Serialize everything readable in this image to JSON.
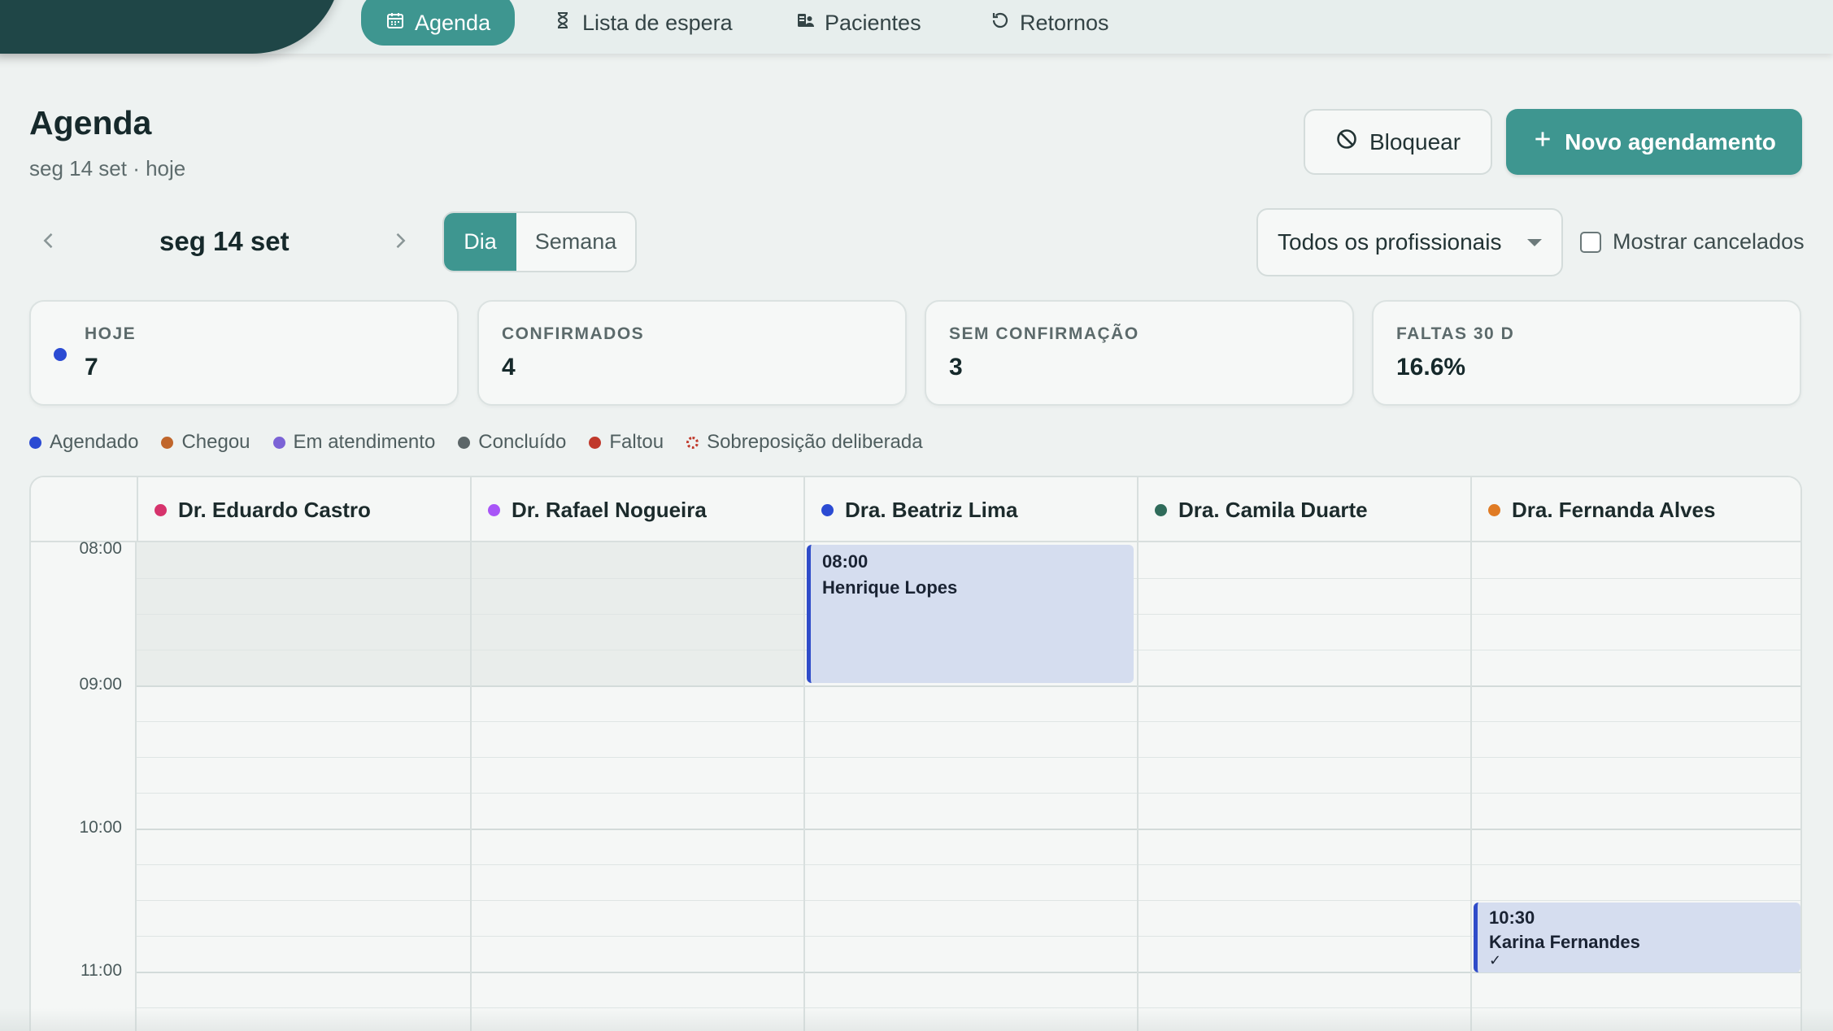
{
  "nav": {
    "items": [
      {
        "label": "Agenda",
        "icon": "calendar-icon",
        "active": true
      },
      {
        "label": "Lista de espera",
        "icon": "hourglass-icon",
        "active": false
      },
      {
        "label": "Pacientes",
        "icon": "patients-icon",
        "active": false
      },
      {
        "label": "Retornos",
        "icon": "return-icon",
        "active": false
      }
    ]
  },
  "header": {
    "title": "Agenda",
    "subtitle": "seg 14 set · hoje",
    "block_label": "Bloquear",
    "new_label": "Novo agendamento"
  },
  "date_nav": {
    "current": "seg 14 set",
    "view_day": "Dia",
    "view_week": "Semana",
    "active_view": "Dia"
  },
  "filters": {
    "professional_select": "Todos os profissionais",
    "show_cancelled_label": "Mostrar cancelados",
    "show_cancelled": false
  },
  "stats": [
    {
      "label": "HOJE",
      "value": "7",
      "dot_color": "#2b4bd3"
    },
    {
      "label": "CONFIRMADOS",
      "value": "4"
    },
    {
      "label": "SEM CONFIRMAÇÃO",
      "value": "3"
    },
    {
      "label": "FALTAS 30 D",
      "value": "16.6%"
    }
  ],
  "legend": [
    {
      "label": "Agendado",
      "color": "#2b4bd3"
    },
    {
      "label": "Chegou",
      "color": "#c0662b"
    },
    {
      "label": "Em atendimento",
      "color": "#7b63d6"
    },
    {
      "label": "Concluído",
      "color": "#5c6668"
    },
    {
      "label": "Faltou",
      "color": "#c0392b"
    },
    {
      "label": "Sobreposição deliberada",
      "color": "#c0392b",
      "style": "dotted-ring"
    }
  ],
  "calendar": {
    "professionals": [
      {
        "name": "Dr. Eduardo Castro",
        "color": "#d6336c"
      },
      {
        "name": "Dr. Rafael Nogueira",
        "color": "#a855f7"
      },
      {
        "name": "Dra. Beatriz Lima",
        "color": "#2b4bd3"
      },
      {
        "name": "Dra. Camila Duarte",
        "color": "#2f6b5a"
      },
      {
        "name": "Dra. Fernanda Alves",
        "color": "#e07b24"
      }
    ],
    "time_labels": [
      "08:00",
      "09:00",
      "10:00",
      "11:00"
    ],
    "appointments": [
      {
        "time": "08:00",
        "patient": "Henrique Lopes",
        "professional": "Dra. Beatriz Lima",
        "confirmed": false
      },
      {
        "time": "10:30",
        "patient": "Karina Fernandes",
        "professional": "Dra. Fernanda Alves",
        "confirmed": true,
        "check": "✓"
      }
    ]
  }
}
